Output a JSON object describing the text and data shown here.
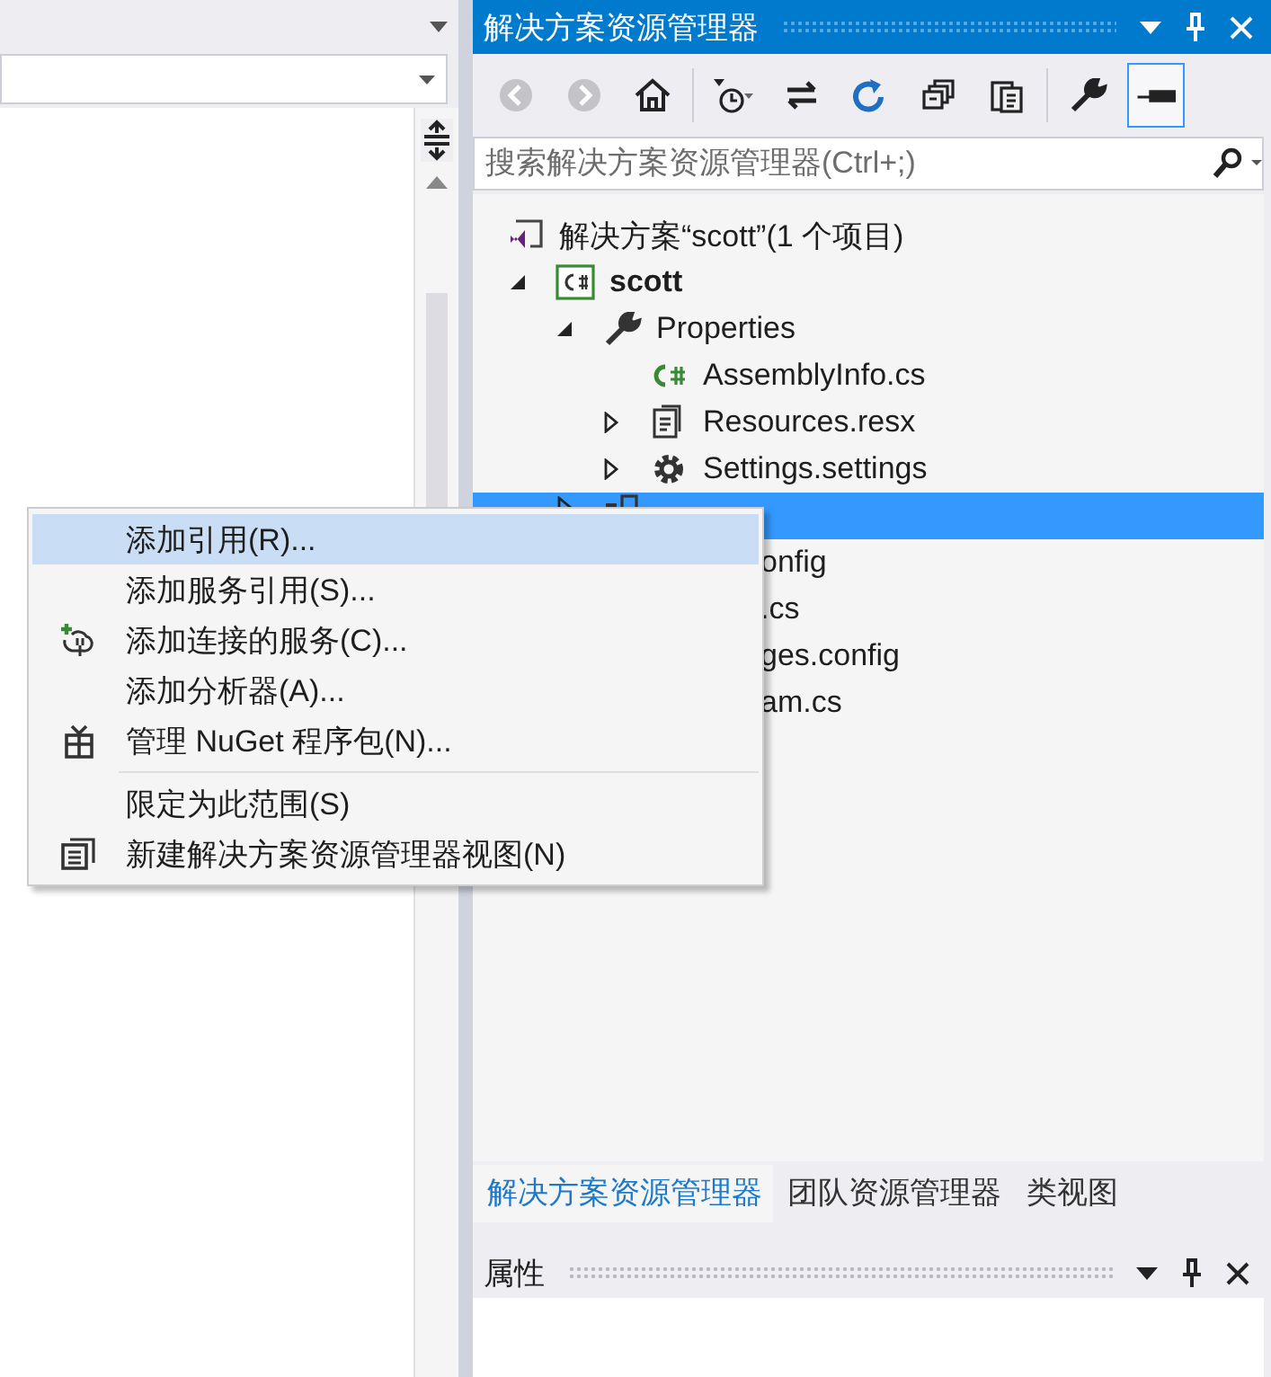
{
  "solution_explorer": {
    "title": "解决方案资源管理器",
    "toolbar": [
      {
        "kind": "back",
        "disabled": true
      },
      {
        "kind": "forward",
        "disabled": true
      },
      {
        "kind": "home",
        "disabled": false
      },
      {
        "kind": "sep"
      },
      {
        "kind": "history",
        "disabled": false
      },
      {
        "kind": "sync",
        "disabled": false
      },
      {
        "kind": "refresh",
        "disabled": false
      },
      {
        "kind": "collapse",
        "disabled": false
      },
      {
        "kind": "copy",
        "disabled": false
      },
      {
        "kind": "sep"
      },
      {
        "kind": "wrench",
        "disabled": false
      },
      {
        "kind": "preview",
        "disabled": false,
        "selected": true
      }
    ],
    "search": {
      "placeholder": "搜索解决方案资源管理器(Ctrl+;)"
    },
    "tree": [
      {
        "label": "解决方案“scott”(1 个项目)",
        "kind": "solution",
        "selected": false,
        "children": [
          {
            "label": "scott",
            "kind": "project",
            "expanded": true,
            "selected": false,
            "children": [
              {
                "label": "Properties",
                "kind": "wrench",
                "expanded": true,
                "selected": false,
                "children": [
                  {
                    "label": "AssemblyInfo.cs",
                    "kind": "cs",
                    "selected": false
                  },
                  {
                    "label": "Resources.resx",
                    "kind": "resx",
                    "expanded": false,
                    "selected": false
                  },
                  {
                    "label": "Settings.settings",
                    "kind": "settings",
                    "expanded": false,
                    "selected": false
                  }
                ]
              },
              {
                "kind": "references",
                "expanded": false,
                "selected": true
              },
              {
                "label": "onfig",
                "kind": "covered",
                "selected": false
              },
              {
                "label": ".cs",
                "kind": "covered",
                "selected": false
              },
              {
                "label": "ges.config",
                "kind": "covered",
                "selected": false
              },
              {
                "label": "am.cs",
                "kind": "covered",
                "selected": false
              }
            ]
          }
        ]
      }
    ],
    "tabs": [
      {
        "label": "解决方案资源管理器",
        "selected": true
      },
      {
        "label": "团队资源管理器",
        "selected": false
      },
      {
        "label": "类视图",
        "selected": false
      }
    ]
  },
  "properties": {
    "title": "属性"
  },
  "context_menu": {
    "items": [
      {
        "kind": "item",
        "label": "添加引用(R)...",
        "selected": true
      },
      {
        "kind": "item",
        "label": "添加服务引用(S)...",
        "selected": false
      },
      {
        "kind": "item",
        "label": "添加连接的服务(C)...",
        "selected": false
      },
      {
        "kind": "item",
        "label": "添加分析器(A)...",
        "selected": false
      },
      {
        "kind": "item",
        "label": "管理 NuGet 程序包(N)...",
        "selected": false
      },
      {
        "kind": "separator"
      },
      {
        "kind": "item",
        "label": "限定为此范围(S)",
        "selected": false
      },
      {
        "kind": "item",
        "label": "新建解决方案资源管理器视图(N)",
        "selected": false
      }
    ]
  }
}
